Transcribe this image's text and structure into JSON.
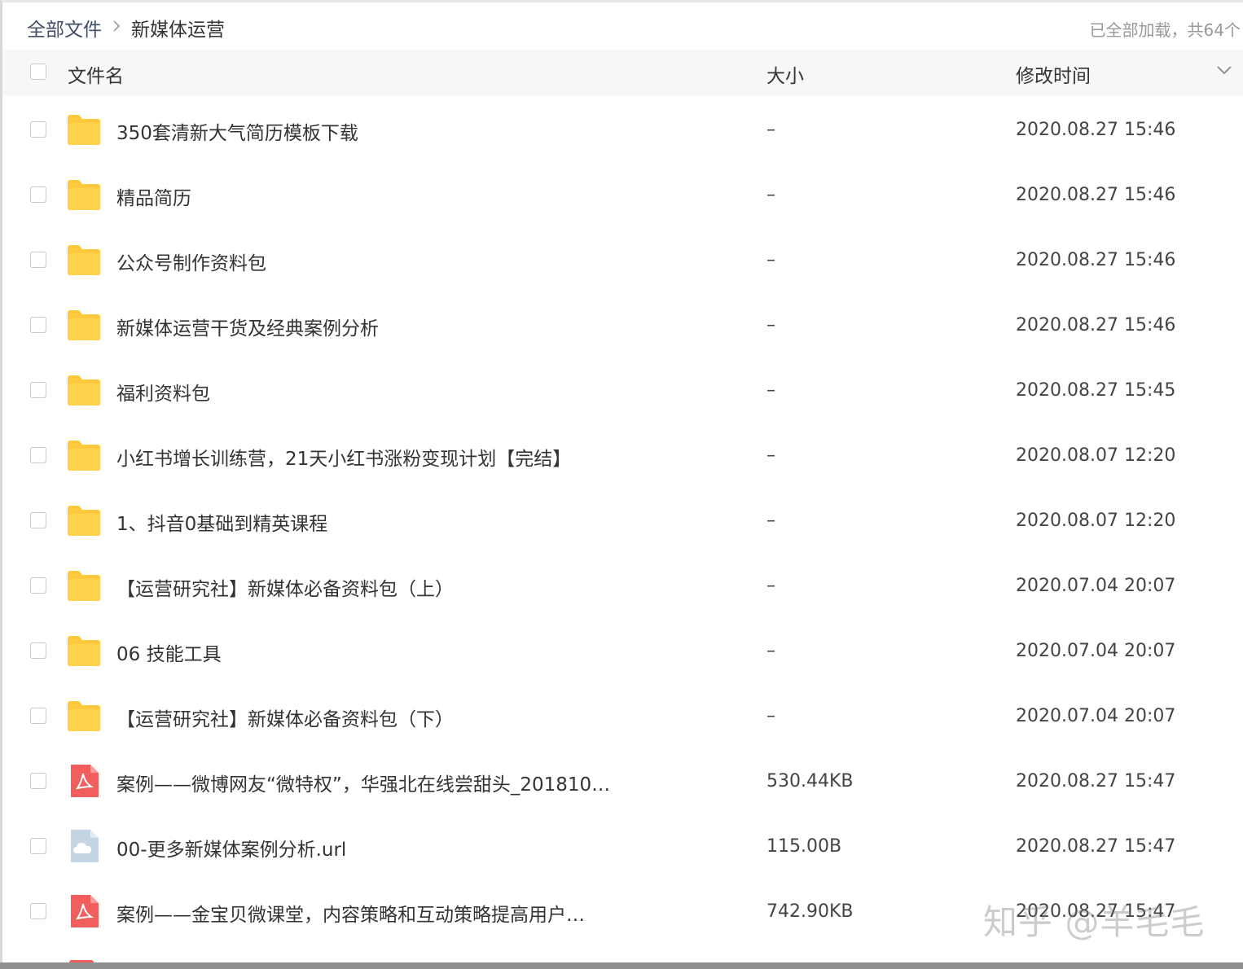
{
  "breadcrumb": {
    "root": "全部文件",
    "separator": ">",
    "current": "新媒体运营"
  },
  "load_status": "已全部加载，共64个",
  "columns": {
    "name": "文件名",
    "size": "大小",
    "time": "修改时间"
  },
  "icons": {
    "folder": "folder-icon",
    "pdf": "pdf-file-icon",
    "url": "url-file-icon",
    "sort": "chevron-down-icon"
  },
  "colors": {
    "folder": "#ffc93d",
    "pdf": "#f25e5e",
    "url": "#c5d4e3",
    "header_bg": "#f7f7f9"
  },
  "files": [
    {
      "type": "folder",
      "name": "350套清新大气简历模板下载",
      "size": "–",
      "time": "2020.08.27 15:46"
    },
    {
      "type": "folder",
      "name": "精品简历",
      "size": "–",
      "time": "2020.08.27 15:46"
    },
    {
      "type": "folder",
      "name": "公众号制作资料包",
      "size": "–",
      "time": "2020.08.27 15:46"
    },
    {
      "type": "folder",
      "name": "新媒体运营干货及经典案例分析",
      "size": "–",
      "time": "2020.08.27 15:46"
    },
    {
      "type": "folder",
      "name": "福利资料包",
      "size": "–",
      "time": "2020.08.27 15:45"
    },
    {
      "type": "folder",
      "name": "小红书增长训练营，21天小红书涨粉变现计划【完结】",
      "size": "–",
      "time": "2020.08.07 12:20"
    },
    {
      "type": "folder",
      "name": "1、抖音0基础到精英课程",
      "size": "–",
      "time": "2020.08.07 12:20"
    },
    {
      "type": "folder",
      "name": "【运营研究社】新媒体必备资料包（上）",
      "size": "–",
      "time": "2020.07.04 20:07"
    },
    {
      "type": "folder",
      "name": "06 技能工具",
      "size": "–",
      "time": "2020.07.04 20:07"
    },
    {
      "type": "folder",
      "name": "【运营研究社】新媒体必备资料包（下）",
      "size": "–",
      "time": "2020.07.04 20:07"
    },
    {
      "type": "pdf",
      "name": "案例——微博网友“微特权”，华强北在线尝甜头_201810…",
      "size": "530.44KB",
      "time": "2020.08.27 15:47"
    },
    {
      "type": "url",
      "name": "00-更多新媒体案例分析.url",
      "size": "115.00B",
      "time": "2020.08.27 15:47"
    },
    {
      "type": "pdf",
      "name": "案例——金宝贝微课堂，内容策略和互动策略提高用户…",
      "size": "742.90KB",
      "time": "2020.08.27 15:47"
    }
  ],
  "watermark": "知乎 @羊毛毛"
}
